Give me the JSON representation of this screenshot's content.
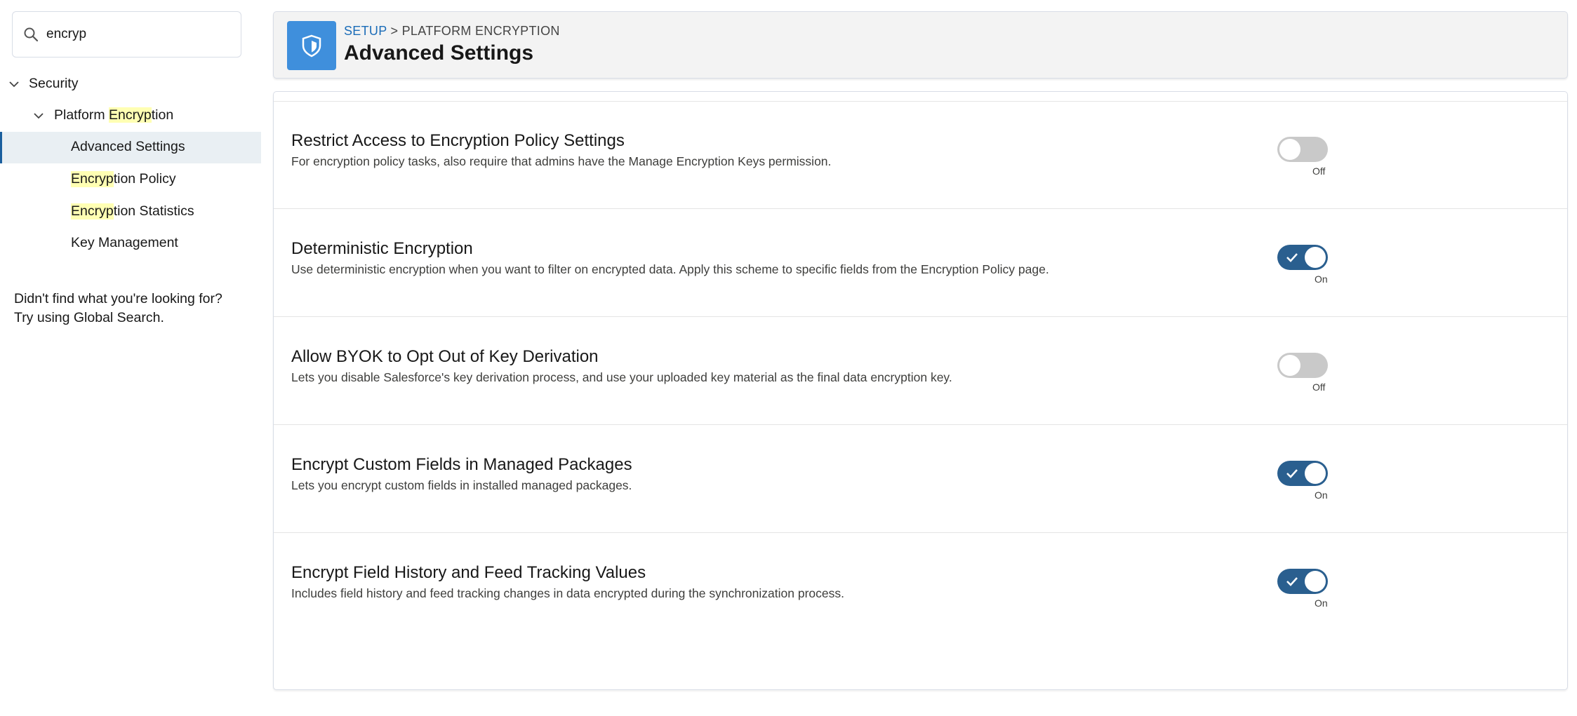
{
  "sidebar": {
    "search_value": "encryp",
    "tree": {
      "security": "Security",
      "platform_pre": "Platform ",
      "platform_hl": "Encryp",
      "platform_post": "tion",
      "advanced_settings": "Advanced Settings",
      "policy_hl": "Encryp",
      "policy_post": "tion Policy",
      "stats_hl": "Encryp",
      "stats_post": "tion Statistics",
      "key_management": "Key Management"
    },
    "help_line1": "Didn't find what you're looking for?",
    "help_line2": "Try using Global Search."
  },
  "header": {
    "breadcrumb_link": "SETUP",
    "breadcrumb_sep": ">",
    "breadcrumb_current": "PLATFORM ENCRYPTION",
    "title": "Advanced Settings"
  },
  "settings": [
    {
      "title": "Restrict Access to Encryption Policy Settings",
      "description": "For encryption policy tasks, also require that admins have the Manage Encryption Keys permission.",
      "state": "Off"
    },
    {
      "title": "Deterministic Encryption",
      "description": "Use deterministic encryption when you want to filter on encrypted data. Apply this scheme to specific fields from the Encryption Policy page.",
      "state": "On"
    },
    {
      "title": "Allow BYOK to Opt Out of Key Derivation",
      "description": "Lets you disable Salesforce's key derivation process, and use your uploaded key material as the final data encryption key.",
      "state": "Off"
    },
    {
      "title": "Encrypt Custom Fields in Managed Packages",
      "description": "Lets you encrypt custom fields in installed managed packages.",
      "state": "On"
    },
    {
      "title": "Encrypt Field History and Feed Tracking Values",
      "description": "Includes field history and feed tracking changes in data encrypted during the synchronization process.",
      "state": "On"
    }
  ],
  "colors": {
    "accent": "#2a5f8f",
    "highlight": "#ffffb3",
    "logo": "#3f8fdc",
    "link": "#1b6cb8"
  }
}
